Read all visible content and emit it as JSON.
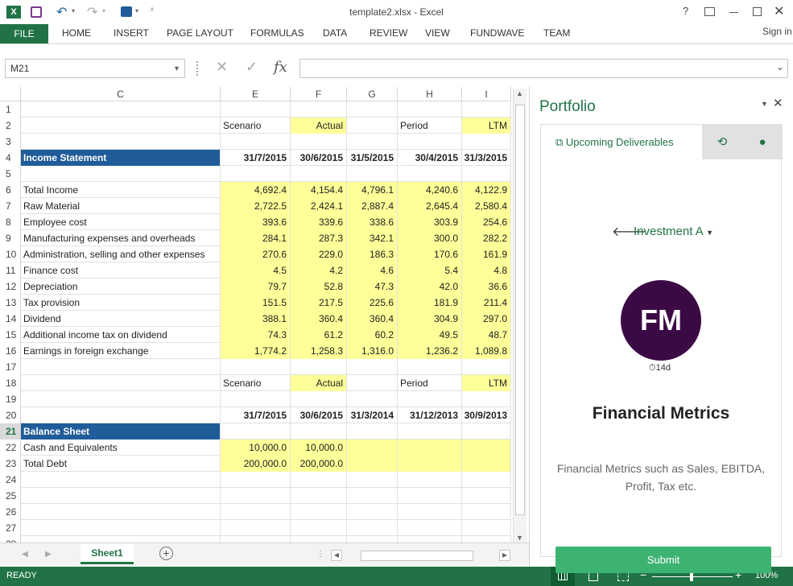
{
  "window": {
    "title": "template2.xlsx - Excel",
    "sign_in": "Sign in"
  },
  "ribbon": {
    "file": "FILE",
    "tabs": [
      "HOME",
      "INSERT",
      "PAGE LAYOUT",
      "FORMULAS",
      "DATA",
      "REVIEW",
      "VIEW",
      "FUNDWAVE",
      "TEAM"
    ]
  },
  "formula_bar": {
    "name_box": "M21",
    "fx": "fx",
    "formula": ""
  },
  "columns": [
    "C",
    "E",
    "F",
    "G",
    "H",
    "I"
  ],
  "rows": [
    {
      "n": "1",
      "cells": [
        "",
        "",
        "",
        "",
        "",
        ""
      ]
    },
    {
      "n": "2",
      "cells": [
        "",
        "Scenario",
        "Actual",
        "",
        "Period",
        "LTM"
      ],
      "kind": "scen"
    },
    {
      "n": "3",
      "cells": [
        "",
        "",
        "",
        "",
        "",
        ""
      ]
    },
    {
      "n": "4",
      "cells": [
        "Income Statement",
        "31/7/2015",
        "30/6/2015",
        "31/5/2015",
        "30/4/2015",
        "31/3/2015"
      ],
      "kind": "head"
    },
    {
      "n": "5",
      "cells": [
        "",
        "",
        "",
        "",
        "",
        ""
      ]
    },
    {
      "n": "6",
      "cells": [
        "Total Income",
        "4,692.4",
        "4,154.4",
        "4,796.1",
        "4,240.6",
        "4,122.9"
      ],
      "kind": "data"
    },
    {
      "n": "7",
      "cells": [
        "Raw Material",
        "2,722.5",
        "2,424.1",
        "2,887.4",
        "2,645.4",
        "2,580.4"
      ],
      "kind": "data"
    },
    {
      "n": "8",
      "cells": [
        "Employee cost",
        "393.6",
        "339.6",
        "338.6",
        "303.9",
        "254.6"
      ],
      "kind": "data"
    },
    {
      "n": "9",
      "cells": [
        "Manufacturing expenses and overheads",
        "284.1",
        "287.3",
        "342.1",
        "300.0",
        "282.2"
      ],
      "kind": "data"
    },
    {
      "n": "10",
      "cells": [
        "Administration, selling and other expenses",
        "270.6",
        "229.0",
        "186.3",
        "170.6",
        "161.9"
      ],
      "kind": "data"
    },
    {
      "n": "11",
      "cells": [
        "Finance cost",
        "4.5",
        "4.2",
        "4.6",
        "5.4",
        "4.8"
      ],
      "kind": "data"
    },
    {
      "n": "12",
      "cells": [
        "Depreciation",
        "79.7",
        "52.8",
        "47.3",
        "42.0",
        "36.6"
      ],
      "kind": "data"
    },
    {
      "n": "13",
      "cells": [
        "Tax provision",
        "151.5",
        "217.5",
        "225.6",
        "181.9",
        "211.4"
      ],
      "kind": "data"
    },
    {
      "n": "14",
      "cells": [
        "Dividend",
        "388.1",
        "360.4",
        "360.4",
        "304.9",
        "297.0"
      ],
      "kind": "data"
    },
    {
      "n": "15",
      "cells": [
        "Additional income tax on dividend",
        "74.3",
        "61.2",
        "60.2",
        "49.5",
        "48.7"
      ],
      "kind": "data"
    },
    {
      "n": "16",
      "cells": [
        "Earnings in foreign exchange",
        "1,774.2",
        "1,258.3",
        "1,316.0",
        "1,236.2",
        "1,089.8"
      ],
      "kind": "data"
    },
    {
      "n": "17",
      "cells": [
        "",
        "",
        "",
        "",
        "",
        ""
      ]
    },
    {
      "n": "18",
      "cells": [
        "",
        "Scenario",
        "Actual",
        "",
        "Period",
        "LTM"
      ],
      "kind": "scen"
    },
    {
      "n": "19",
      "cells": [
        "",
        "",
        "",
        "",
        "",
        ""
      ]
    },
    {
      "n": "20",
      "cells": [
        "",
        "31/7/2015",
        "30/6/2015",
        "31/3/2014",
        "31/12/2013",
        "30/9/2013"
      ],
      "kind": "dates"
    },
    {
      "n": "21",
      "cells": [
        "Balance Sheet",
        "",
        "",
        "",
        "",
        ""
      ],
      "kind": "head"
    },
    {
      "n": "22",
      "cells": [
        "Cash and Equivalents",
        "10,000.0",
        "10,000.0",
        "",
        "",
        ""
      ],
      "kind": "data"
    },
    {
      "n": "23",
      "cells": [
        "Total Debt",
        "200,000.0",
        "200,000.0",
        "",
        "",
        ""
      ],
      "kind": "data"
    },
    {
      "n": "24",
      "cells": [
        "",
        "",
        "",
        "",
        "",
        ""
      ]
    },
    {
      "n": "25",
      "cells": [
        "",
        "",
        "",
        "",
        "",
        ""
      ]
    },
    {
      "n": "26",
      "cells": [
        "",
        "",
        "",
        "",
        "",
        ""
      ]
    },
    {
      "n": "27",
      "cells": [
        "",
        "",
        "",
        "",
        "",
        ""
      ]
    },
    {
      "n": "28",
      "cells": [
        "",
        "",
        "",
        "",
        "",
        ""
      ]
    }
  ],
  "sheet_tabs": {
    "active": "Sheet1"
  },
  "status": {
    "ready": "READY",
    "zoom": "100%"
  },
  "pane": {
    "title": "Portfolio",
    "tab_deliverables": "Upcoming Deliverables",
    "investment": "Investment A",
    "avatar_initials": "FM",
    "due": "14d",
    "heading": "Financial Metrics",
    "description": "Financial Metrics such as Sales, EBITDA, Profit, Tax etc.",
    "submit": "Submit"
  },
  "colors": {
    "excel_green": "#217346",
    "header_blue": "#1f5c99",
    "yellow": "#ffff99",
    "avatar": "#3b0a45",
    "submit": "#3cb371"
  }
}
